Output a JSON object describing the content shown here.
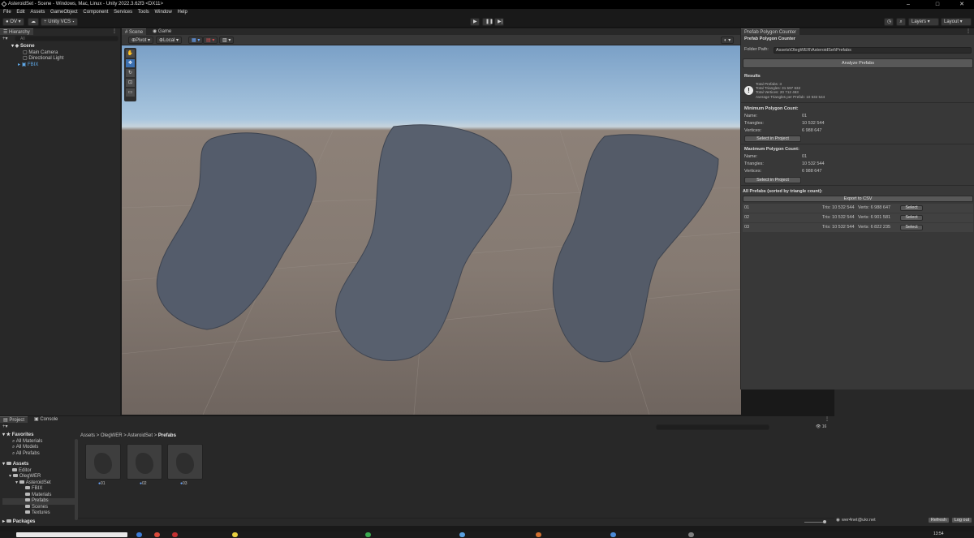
{
  "window": {
    "title": "AsteroidSet - Scene - Windows, Mac, Linux - Unity 2022.3.62f3 <DX11>",
    "controls": [
      "–",
      "□",
      "✕"
    ]
  },
  "menu": [
    "File",
    "Edit",
    "Assets",
    "GameObject",
    "Component",
    "Services",
    "Tools",
    "Window",
    "Help"
  ],
  "toolbar": {
    "account": "OV",
    "vcs": "Unity VCS",
    "layers": "Layers",
    "layout": "Layout"
  },
  "hierarchy": {
    "tab": "Hierarchy",
    "search_placeholder": "All",
    "scene": "Scene",
    "items": [
      "Main Camera",
      "Directional Light",
      "FBIX"
    ]
  },
  "scene_view": {
    "tabs": [
      "Scene",
      "Game"
    ],
    "pivot": "Pivot",
    "local": "Local"
  },
  "counter": {
    "tab": "Prefab Polygon Counter",
    "title": "Prefab Polygon Counter",
    "folder_label": "Folder Path:",
    "folder_value": "Assets\\OlegWER\\AsteroidSet\\Prefabs",
    "analyze": "Analyze Prefabs",
    "results_label": "Results",
    "summary": [
      "Total Prefabs: 3",
      "Total Triangles: 31 597 632",
      "Total Vertices: 20 712 463",
      "Average Triangles per Prefab: 10 532 544"
    ],
    "min": {
      "header": "Minimum Polygon Count:",
      "name_label": "Name:",
      "name": "01",
      "tris_label": "Triangles:",
      "tris": "10 532 544",
      "verts_label": "Vertices:",
      "verts": "6 988 647",
      "select": "Select in Project"
    },
    "max": {
      "header": "Maximum Polygon Count:",
      "name_label": "Name:",
      "name": "01",
      "tris_label": "Triangles:",
      "tris": "10 532 544",
      "verts_label": "Vertices:",
      "verts": "6 988 647",
      "select": "Select in Project"
    },
    "all_header": "All Prefabs (sorted by triangle count):",
    "export": "Export to CSV",
    "rows": [
      {
        "name": "01",
        "tris": "Tris: 10 532 544",
        "verts": "Verts: 6 988 647",
        "select": "Select"
      },
      {
        "name": "02",
        "tris": "Tris: 10 532 544",
        "verts": "Verts: 6 901 581",
        "select": "Select"
      },
      {
        "name": "03",
        "tris": "Tris: 10 532 544",
        "verts": "Verts: 6 822 235",
        "select": "Select"
      }
    ]
  },
  "project": {
    "tabs": [
      "Project",
      "Console"
    ],
    "favorites": "Favorites",
    "fav_items": [
      "All Materials",
      "All Models",
      "All Prefabs"
    ],
    "assets": "Assets",
    "tree": [
      "Editor",
      "OlegWER",
      "AsteroidSet",
      "FBIX",
      "Materials",
      "Prefabs",
      "Scenes",
      "Textures"
    ],
    "packages": "Packages",
    "breadcrumb": [
      "Assets",
      "OlegWER",
      "AsteroidSet",
      "Prefabs"
    ],
    "assets_list": [
      "01",
      "02",
      "03"
    ],
    "count": "16"
  },
  "account_bar": {
    "email": "wer4net@ukr.net",
    "refresh": "Refresh",
    "logout": "Log out"
  },
  "clock": "13:54"
}
